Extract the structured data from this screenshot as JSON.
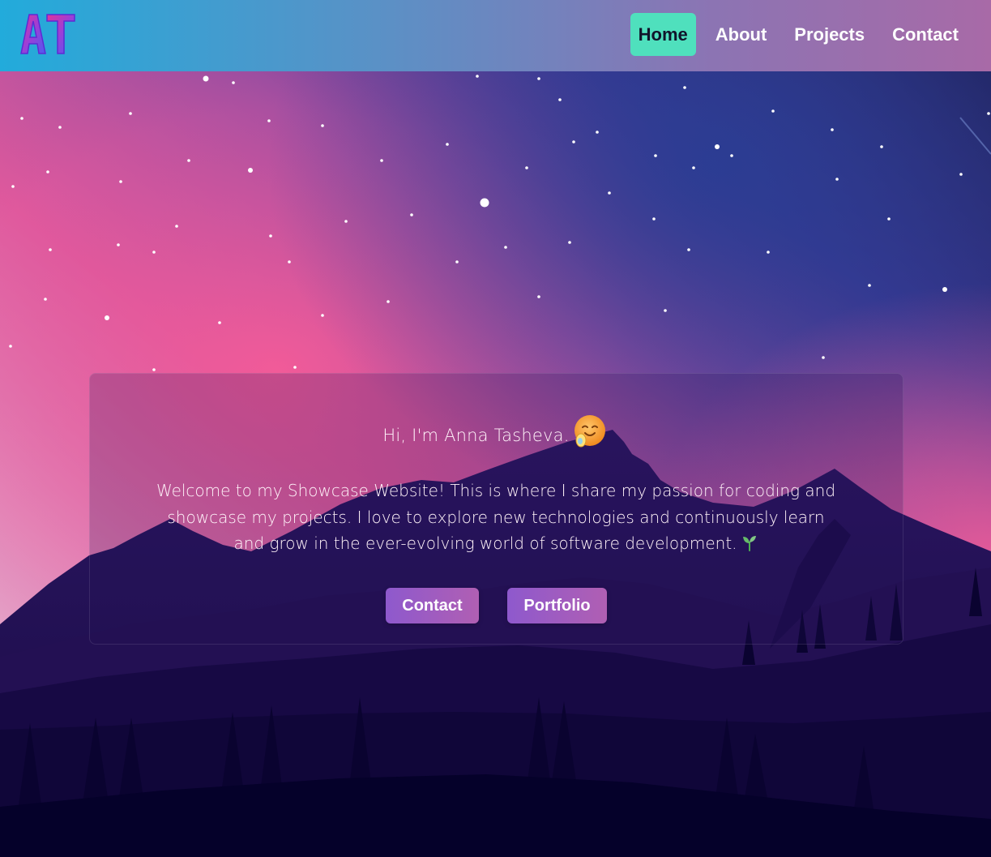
{
  "nav": {
    "logo_text": "AT",
    "items": [
      {
        "label": "Home",
        "active": true
      },
      {
        "label": "About",
        "active": false
      },
      {
        "label": "Projects",
        "active": false
      },
      {
        "label": "Contact",
        "active": false
      }
    ]
  },
  "hero": {
    "greeting": "Hi, I'm Anna Tasheva.",
    "greeting_icon": "hugging-face-emoji-icon",
    "welcome": "Welcome to my Showcase Website! This is where I share my passion for coding and showcase my projects. I love to explore new technologies and continuously learn and grow in the ever-evolving world of software development.",
    "welcome_icon": "seedling-emoji-icon",
    "buttons": {
      "contact": "Contact",
      "portfolio": "Portfolio"
    }
  },
  "colors": {
    "nav_active_bg": "#4fe0bd",
    "button_start": "#8e59cd",
    "button_end": "#b05fb3",
    "sky_pink": "#f15c9a",
    "sky_blue": "#2a3a8c",
    "mountain_dark": "#1d0e4a"
  }
}
